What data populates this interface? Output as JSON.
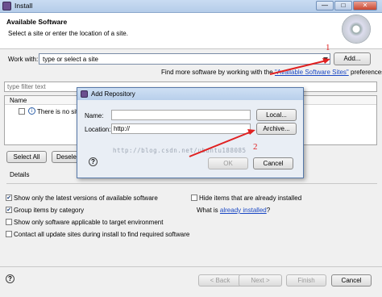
{
  "window": {
    "title": "Install",
    "min_label": "—",
    "max_label": "□",
    "close_label": "✕"
  },
  "header": {
    "title": "Available Software",
    "subtitle": "Select a site or enter the location of a site."
  },
  "work_with": {
    "label": "Work with:",
    "value": "type or select a site",
    "add_button": "Add..."
  },
  "find_more": {
    "prefix": "Find more software by working with the ",
    "link": "\"Available Software Sites\"",
    "suffix": " preferences."
  },
  "filter": {
    "placeholder": "type filter text"
  },
  "tree": {
    "header": "Name",
    "item": "There is no site"
  },
  "buttons": {
    "select_all": "Select All",
    "deselect": "Deselect"
  },
  "details": {
    "label": "Details"
  },
  "options": {
    "show_latest": {
      "label": "Show only the latest versions of available software",
      "checked": true
    },
    "group": {
      "label": "Group items by category",
      "checked": true
    },
    "applicable": {
      "label": "Show only software applicable to target environment",
      "checked": false
    },
    "contact": {
      "label": "Contact all update sites during install to find required software",
      "checked": false
    },
    "hide_installed": {
      "label": "Hide items that are already installed",
      "checked": false
    },
    "what_is": {
      "prefix": "What is ",
      "link": "already installed",
      "suffix": "?"
    }
  },
  "footer": {
    "back": "< Back",
    "next": "Next >",
    "finish": "Finish",
    "cancel": "Cancel"
  },
  "dialog": {
    "title": "Add Repository",
    "name_label": "Name:",
    "name_value": "",
    "local_button": "Local...",
    "location_label": "Location:",
    "location_value": "http://",
    "archive_button": "Archive...",
    "ok_button": "OK",
    "cancel_button": "Cancel"
  },
  "annotations": {
    "one": "1",
    "two": "2",
    "watermark": "http://blog.csdn.net/ubuntu188085"
  },
  "colors": {
    "accent_link": "#1a48c4",
    "annotation": "#e02020"
  }
}
